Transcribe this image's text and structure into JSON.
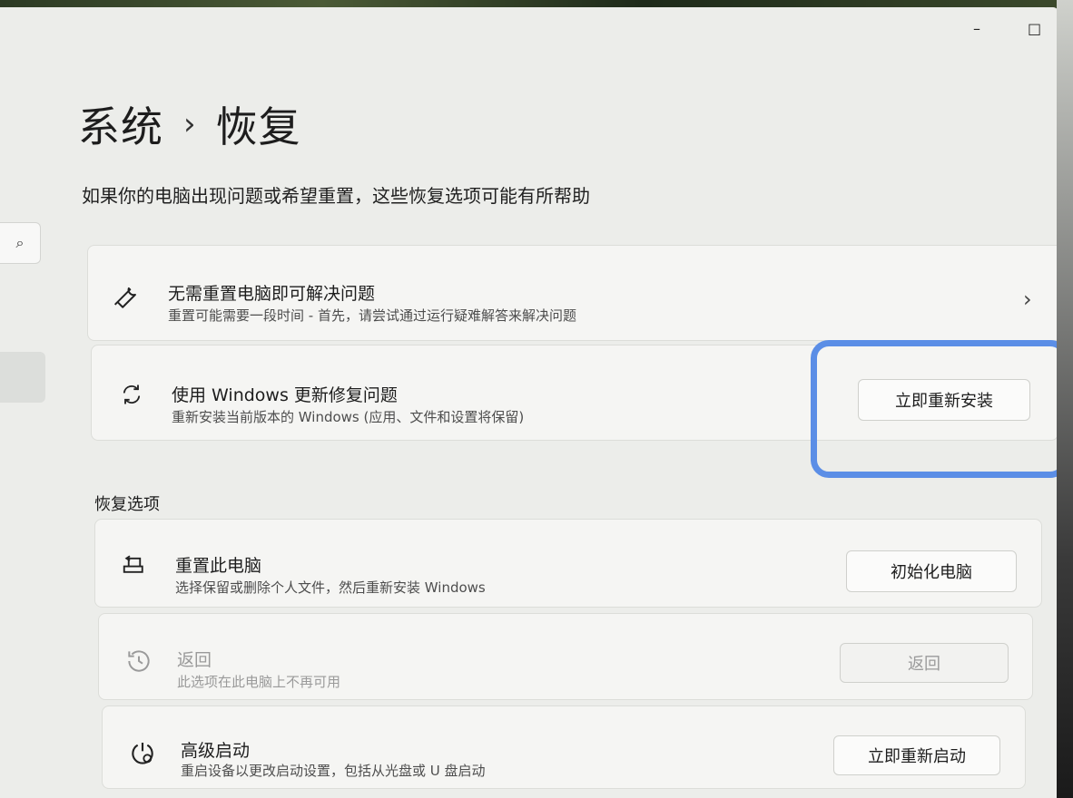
{
  "window": {
    "min_label": "–",
    "max_label": "□"
  },
  "header": {
    "parent": "系统",
    "separator": "›",
    "current": "恢复"
  },
  "intro": "如果你的电脑出现问题或希望重置，这些恢复选项可能有所帮助",
  "search_icon": "⌕",
  "cards": {
    "fix": {
      "icon": "wrench-icon",
      "title": "无需重置电脑即可解决问题",
      "desc": "重置可能需要一段时间 - 首先，请尝试通过运行疑难解答来解决问题",
      "chevron": "›"
    },
    "update": {
      "icon": "refresh-icon",
      "title": "使用 Windows 更新修复问题",
      "desc": "重新安装当前版本的 Windows (应用、文件和设置将保留)",
      "button": "立即重新安装"
    }
  },
  "section_label": "恢复选项",
  "options": {
    "reset": {
      "icon": "reset-pc-icon",
      "title": "重置此电脑",
      "desc": "选择保留或删除个人文件，然后重新安装 Windows",
      "button": "初始化电脑"
    },
    "goback": {
      "icon": "history-icon",
      "title": "返回",
      "desc": "此选项在此电脑上不再可用",
      "button": "返回"
    },
    "advanced": {
      "icon": "advanced-startup-icon",
      "title": "高级启动",
      "desc": "重启设备以更改启动设置，包括从光盘或 U 盘启动",
      "button": "立即重新启动"
    }
  },
  "accent_color": "#5b8ee6"
}
